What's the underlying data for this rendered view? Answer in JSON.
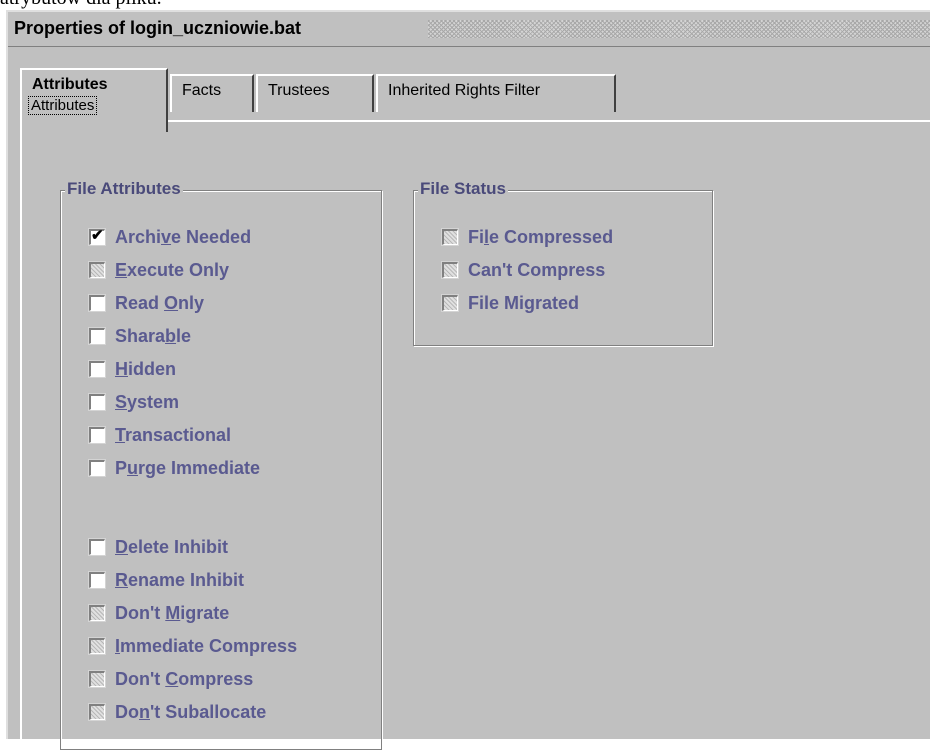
{
  "background_text": "atrybutów dla pliku.",
  "window": {
    "title": "Properties of login_uczniowie.bat"
  },
  "tabs": [
    {
      "label": "Attributes",
      "sublabel": "Attributes",
      "active": true
    },
    {
      "label": "Facts"
    },
    {
      "label": "Trustees"
    },
    {
      "label": "Inherited Rights Filter"
    }
  ],
  "file_attributes": {
    "legend": "File Attributes",
    "items": [
      {
        "pre": "Archi",
        "u": "v",
        "post": "e Needed",
        "checked": true,
        "disabled": false
      },
      {
        "pre": "",
        "u": "E",
        "post": "xecute Only",
        "checked": false,
        "disabled": true
      },
      {
        "pre": "Read ",
        "u": "O",
        "post": "nly",
        "checked": false,
        "disabled": false
      },
      {
        "pre": "Shara",
        "u": "b",
        "post": "le",
        "checked": false,
        "disabled": false
      },
      {
        "pre": "",
        "u": "H",
        "post": "idden",
        "checked": false,
        "disabled": false
      },
      {
        "pre": "",
        "u": "S",
        "post": "ystem",
        "checked": false,
        "disabled": false
      },
      {
        "pre": "",
        "u": "T",
        "post": "ransactional",
        "checked": false,
        "disabled": false
      },
      {
        "pre": "P",
        "u": "u",
        "post": "rge Immediate",
        "checked": false,
        "disabled": false
      },
      {
        "pre": "",
        "u": "D",
        "post": "elete Inhibit",
        "checked": false,
        "disabled": false
      },
      {
        "pre": "",
        "u": "R",
        "post": "ename Inhibit",
        "checked": false,
        "disabled": false
      },
      {
        "pre": "Don't ",
        "u": "M",
        "post": "igrate",
        "checked": false,
        "disabled": true
      },
      {
        "pre": "",
        "u": "I",
        "post": "mmediate Compress",
        "checked": false,
        "disabled": true
      },
      {
        "pre": "Don't ",
        "u": "C",
        "post": "ompress",
        "checked": false,
        "disabled": true
      },
      {
        "pre": "Do",
        "u": "n",
        "post": "'t Suballocate",
        "checked": false,
        "disabled": true
      }
    ]
  },
  "file_status": {
    "legend": "File Status",
    "items": [
      {
        "pre": "Fi",
        "u": "l",
        "post": "e Compressed",
        "checked": false,
        "disabled": true
      },
      {
        "pre": "Can't Compress",
        "u": "",
        "post": "",
        "checked": false,
        "disabled": true
      },
      {
        "pre": "File Migrated",
        "u": "",
        "post": "",
        "checked": false,
        "disabled": true
      }
    ]
  }
}
